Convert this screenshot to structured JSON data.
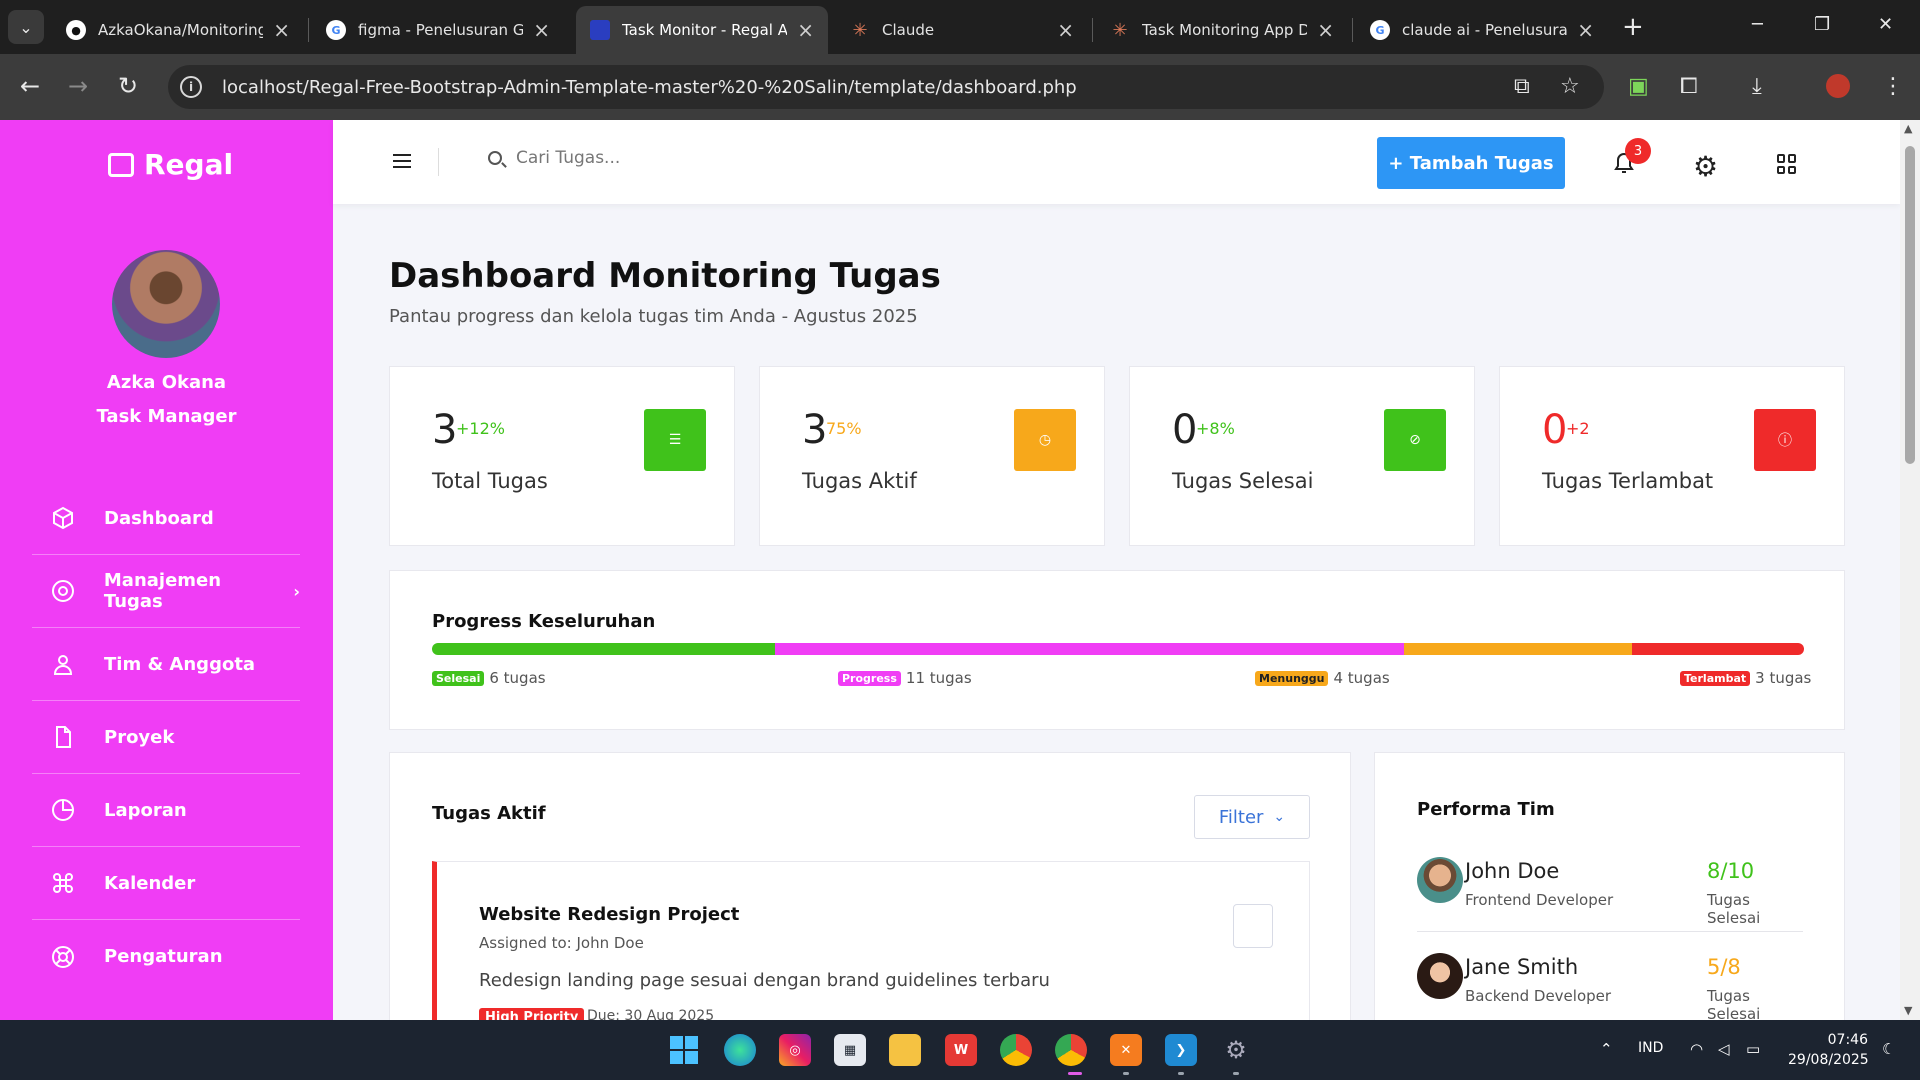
{
  "browser": {
    "tabs": [
      {
        "title": "AzkaOkana/Monitoring-",
        "icon": "github-icon"
      },
      {
        "title": "figma - Penelusuran Goo",
        "icon": "google-icon"
      },
      {
        "title": "Task Monitor - Regal Ad",
        "icon": "regal-icon",
        "active": true
      },
      {
        "title": "Claude",
        "icon": "claude-icon"
      },
      {
        "title": "Task Monitoring App De",
        "icon": "claude-icon"
      },
      {
        "title": "claude ai - Penelusuran",
        "icon": "google-icon"
      }
    ],
    "url": "localhost/Regal-Free-Bootstrap-Admin-Template-master%20-%20Salin/template/dashboard.php"
  },
  "sidebar": {
    "brand": "Regal",
    "user_name": "Azka Okana",
    "user_role": "Task Manager",
    "items": [
      {
        "label": "Dashboard",
        "icon": "cube-icon"
      },
      {
        "label": "Manajemen Tugas",
        "icon": "target-icon",
        "has_submenu": true
      },
      {
        "label": "Tim & Anggota",
        "icon": "user-icon"
      },
      {
        "label": "Proyek",
        "icon": "file-icon"
      },
      {
        "label": "Laporan",
        "icon": "pie-chart-icon"
      },
      {
        "label": "Kalender",
        "icon": "command-icon"
      },
      {
        "label": "Pengaturan",
        "icon": "lifebuoy-icon"
      }
    ]
  },
  "topnav": {
    "search_placeholder": "Cari Tugas...",
    "add_button": "+ Tambah Tugas",
    "notification_count": "3"
  },
  "page": {
    "title": "Dashboard Monitoring Tugas",
    "subtitle": "Pantau progress dan kelola tugas tim Anda - Agustus 2025"
  },
  "stats": [
    {
      "value": "3",
      "change": "+12%",
      "label": "Total Tugas",
      "color": "#40c21b",
      "change_color": "#40c21b",
      "value_color": "#222222",
      "icon": "list-icon"
    },
    {
      "value": "3",
      "change": "75%",
      "label": "Tugas Aktif",
      "color": "#f7a81b",
      "change_color": "#f7a81b",
      "value_color": "#222222",
      "icon": "clock-icon"
    },
    {
      "value": "0",
      "change": "+8%",
      "label": "Tugas Selesai",
      "color": "#40c21b",
      "change_color": "#40c21b",
      "value_color": "#222222",
      "icon": "check-circle-icon"
    },
    {
      "value": "0",
      "change": "+2",
      "label": "Tugas Terlambat",
      "color": "#ef2a2a",
      "change_color": "#ef2a2a",
      "value_color": "#ef2a2a",
      "icon": "alert-circle-icon"
    }
  ],
  "progress": {
    "title": "Progress Keseluruhan",
    "segments": [
      {
        "tag": "Selesai",
        "text": "6 tugas",
        "count": 6,
        "color": "#40c21b"
      },
      {
        "tag": "Progress",
        "text": "11 tugas",
        "count": 11,
        "color": "#f03df5"
      },
      {
        "tag": "Menunggu",
        "text": "4 tugas",
        "count": 4,
        "color": "#f7a81b"
      },
      {
        "tag": "Terlambat",
        "text": "3 tugas",
        "count": 3,
        "color": "#ef2a2a"
      }
    ]
  },
  "tasks": {
    "title": "Tugas Aktif",
    "filter_label": "Filter",
    "items": [
      {
        "name": "Website Redesign Project",
        "assigned": "Assigned to: John Doe",
        "description": "Redesign landing page sesuai dengan brand guidelines terbaru",
        "priority": "High Priority",
        "due": "Due: 30 Aug 2025"
      }
    ]
  },
  "performance": {
    "title": "Performa Tim",
    "members": [
      {
        "name": "John Doe",
        "role": "Frontend Developer",
        "score": "8/10",
        "score_label": "Tugas Selesai",
        "color": "#40c21b"
      },
      {
        "name": "Jane Smith",
        "role": "Backend Developer",
        "score": "5/8",
        "score_label": "Tugas Selesai",
        "color": "#f7a81b"
      }
    ]
  },
  "system": {
    "language": "IND",
    "time": "07:46",
    "date": "29/08/2025"
  }
}
